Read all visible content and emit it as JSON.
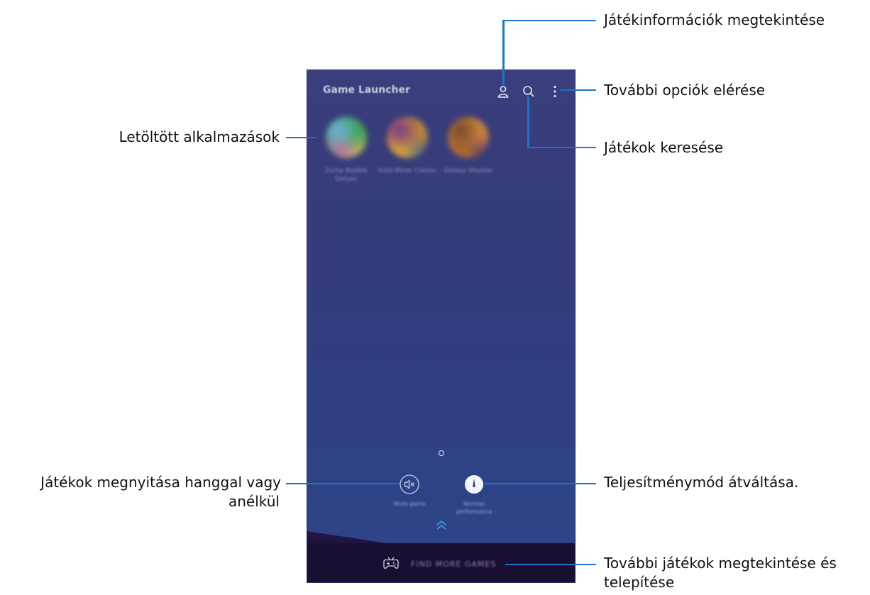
{
  "phone": {
    "app_title": "Game Launcher",
    "games": [
      {
        "label": "Zuma Bubble Deluxe",
        "colors": [
          "#6db0d8",
          "#3aa05a",
          "#c46aa4",
          "#e0c452"
        ]
      },
      {
        "label": "Gold Miner Classic",
        "colors": [
          "#7b3a8e",
          "#c88a2c",
          "#e2a938",
          "#2f5fa8"
        ]
      },
      {
        "label": "Galaxy Shooter",
        "colors": [
          "#7a4a2a",
          "#d08a3a",
          "#b06a2a",
          "#503070"
        ]
      }
    ],
    "mute_label": "Mute game",
    "performance_label": "Normal performance",
    "find_more_label": "FIND MORE GAMES"
  },
  "callouts": {
    "game_info": "Játékinformációk megtekintése",
    "more_options": "További opciók elérése",
    "downloaded_apps": "Letöltött alkalmazások",
    "search_games": "Játékok keresése",
    "sound_line1": "Játékok megnyitása hanggal vagy",
    "sound_line2": "anélkül",
    "performance_mode": "Teljesítménymód átváltása.",
    "more_games_line1": "További játékok megtekintése és",
    "more_games_line2": "telepítése"
  },
  "colors": {
    "leader": "#1976c8",
    "accent_chevron": "#3fa0ff"
  }
}
